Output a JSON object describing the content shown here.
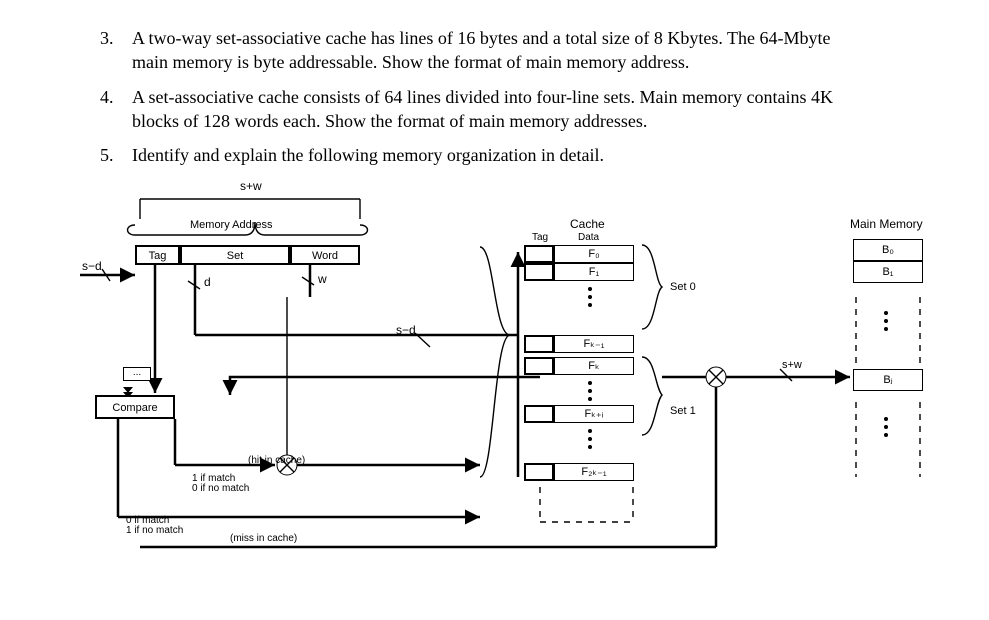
{
  "questions": [
    {
      "num": "3.",
      "text": "A two-way set-associative cache has lines of 16 bytes and a total size of 8 Kbytes.  The 64-Mbyte main memory is byte addressable.  Show the format of main memory address."
    },
    {
      "num": "4.",
      "text": "A set-associative cache consists of 64 lines divided into four-line sets.  Main memory contains 4K blocks of 128 words each.  Show the format of main memory addresses."
    },
    {
      "num": "5.",
      "text": "Identify and explain the following memory organization in detail."
    }
  ],
  "diagram": {
    "width_label_top": "s+w",
    "memory_address_title": "Memory Address",
    "tag_label": "Tag",
    "set_label": "Set",
    "word_label": "Word",
    "sd_label": "s−d",
    "d_label": "d",
    "w_label": "w",
    "compare_label": "Compare",
    "hit_in_cache": "(hit in cache)",
    "miss_in_cache": "(miss in cache)",
    "hit_detail_1": "1 if match",
    "hit_detail_0": "0 if no match",
    "miss_detail_0": "0 if match",
    "miss_detail_1": "1 if no match",
    "cache_title": "Cache",
    "cache_tag": "Tag",
    "cache_data": "Data",
    "set0": "Set 0",
    "set1": "Set 1",
    "F0": "F₀",
    "F1": "F₁",
    "Fkm1": "Fₖ₋₁",
    "Fk": "Fₖ",
    "Fki": "Fₖ₊ᵢ",
    "F2km1": "F₂ₖ₋₁",
    "mm_title": "Main Memory",
    "B0": "B₀",
    "B1": "B₁",
    "Bj": "Bⱼ",
    "sw_right": "s+w"
  }
}
